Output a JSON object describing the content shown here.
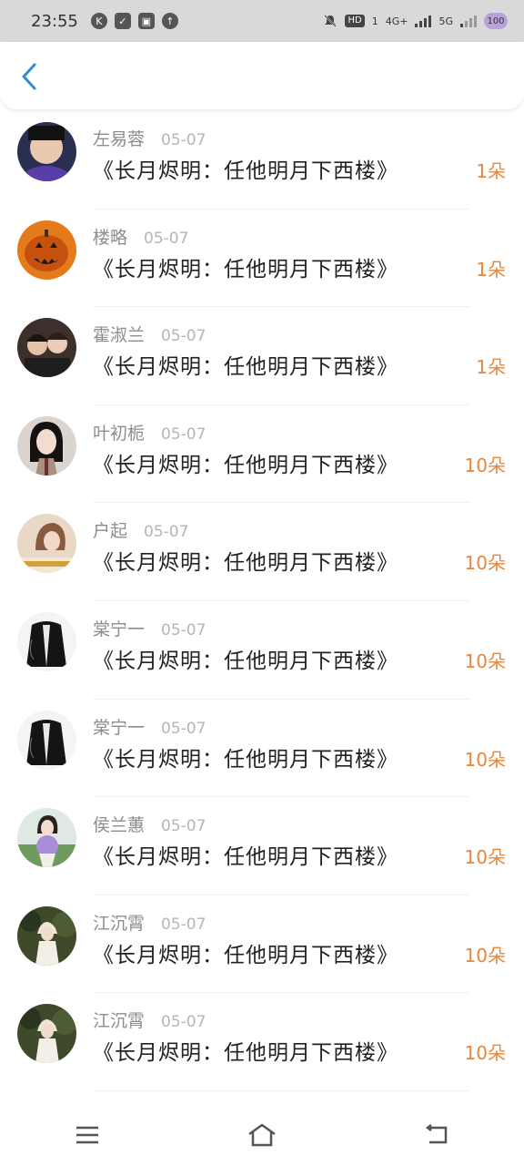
{
  "status": {
    "time": "23:55",
    "left_icons": [
      "K",
      "✓",
      "▣",
      "↑"
    ],
    "hd": "HD",
    "sim": "1",
    "net1": "4G+",
    "net2": "5G",
    "battery": "100"
  },
  "header": {
    "back_icon": "chevron-left-icon"
  },
  "colors": {
    "accent": "#2b8fd6",
    "gift": "#e8863a"
  },
  "items": [
    {
      "name": "左易蓉",
      "date": "05-07",
      "title": "《长月烬明：任他明月下西楼》",
      "gift": "1朵",
      "avatar_color": "#2a2f52"
    },
    {
      "name": "楼略",
      "date": "05-07",
      "title": "《长月烬明：任他明月下西楼》",
      "gift": "1朵",
      "avatar_color": "#e57a1a"
    },
    {
      "name": "霍淑兰",
      "date": "05-07",
      "title": "《长月烬明：任他明月下西楼》",
      "gift": "1朵",
      "avatar_color": "#6d5a4e"
    },
    {
      "name": "叶初栀",
      "date": "05-07",
      "title": "《长月烬明：任他明月下西楼》",
      "gift": "10朵",
      "avatar_color": "#c9bfb8"
    },
    {
      "name": "户起",
      "date": "05-07",
      "title": "《长月烬明：任他明月下西楼》",
      "gift": "10朵",
      "avatar_color": "#d7b79b"
    },
    {
      "name": "棠宁一",
      "date": "05-07",
      "title": "《长月烬明：任他明月下西楼》",
      "gift": "10朵",
      "avatar_color": "#1d1d1d"
    },
    {
      "name": "棠宁一",
      "date": "05-07",
      "title": "《长月烬明：任他明月下西楼》",
      "gift": "10朵",
      "avatar_color": "#1d1d1d"
    },
    {
      "name": "侯兰蕙",
      "date": "05-07",
      "title": "《长月烬明：任他明月下西楼》",
      "gift": "10朵",
      "avatar_color": "#7fa86a"
    },
    {
      "name": "江沉霄",
      "date": "05-07",
      "title": "《长月烬明：任他明月下西楼》",
      "gift": "10朵",
      "avatar_color": "#5a6a3d"
    },
    {
      "name": "江沉霄",
      "date": "05-07",
      "title": "《长月烬明：任他明月下西楼》",
      "gift": "10朵",
      "avatar_color": "#5a6a3d"
    }
  ],
  "navbar": {
    "icons": [
      "menu-icon",
      "home-icon",
      "back-icon"
    ]
  }
}
